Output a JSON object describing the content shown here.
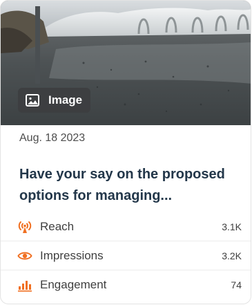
{
  "card": {
    "badge_label": "Image",
    "date": "Aug. 18 2023",
    "title": "Have your say on the proposed options for managing...",
    "accent_color": "#f07022",
    "metrics": [
      {
        "label": "Reach",
        "value": "3.1K",
        "icon": "broadcast-icon"
      },
      {
        "label": "Impressions",
        "value": "3.2K",
        "icon": "eye-icon"
      },
      {
        "label": "Engagement",
        "value": "74",
        "icon": "bar-chart-icon"
      }
    ]
  }
}
